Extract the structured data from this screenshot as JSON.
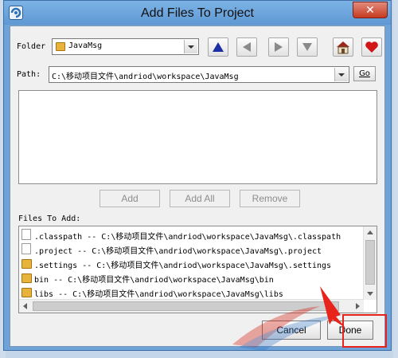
{
  "window": {
    "title": "Add Files To Project",
    "close_label": "✕"
  },
  "folder": {
    "label": "Folder",
    "value": "JavaMsg"
  },
  "path": {
    "label": "Path:",
    "value": "C:\\移动项目文件\\andriod\\workspace\\JavaMsg",
    "go_label": "Go"
  },
  "toolbar": {
    "icons": [
      "up-triangle-icon",
      "left-arrow-icon",
      "right-arrow-icon",
      "down-arrow-icon",
      "home-icon",
      "heart-icon"
    ]
  },
  "actions": {
    "add_label": "Add",
    "add_all_label": "Add All",
    "remove_label": "Remove"
  },
  "files": {
    "label": "Files To Add:",
    "items": [
      {
        "type": "file",
        "text": ".classpath -- C:\\移动项目文件\\andriod\\workspace\\JavaMsg\\.classpath"
      },
      {
        "type": "file",
        "text": ".project -- C:\\移动项目文件\\andriod\\workspace\\JavaMsg\\.project"
      },
      {
        "type": "folder",
        "text": ".settings -- C:\\移动项目文件\\andriod\\workspace\\JavaMsg\\.settings"
      },
      {
        "type": "folder",
        "text": "bin -- C:\\移动项目文件\\andriod\\workspace\\JavaMsg\\bin"
      },
      {
        "type": "folder",
        "text": "libs -- C:\\移动项目文件\\andriod\\workspace\\JavaMsg\\libs"
      }
    ]
  },
  "buttons": {
    "cancel_label": "Cancel",
    "done_label": "Done"
  },
  "colors": {
    "titlebar": "#6fa3d8",
    "close": "#c73b22",
    "highlight": "#e8231b"
  }
}
